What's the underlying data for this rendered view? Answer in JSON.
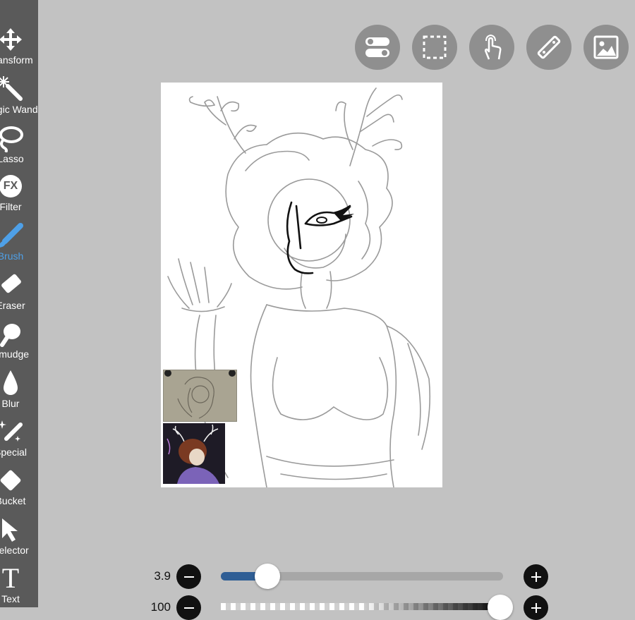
{
  "toolbar": {
    "tools": [
      {
        "id": "transform",
        "label": "Transform",
        "icon": "move-arrows-icon"
      },
      {
        "id": "magic-wand",
        "label": "Magic Wand",
        "icon": "magic-wand-icon"
      },
      {
        "id": "lasso",
        "label": "Lasso",
        "icon": "lasso-icon"
      },
      {
        "id": "filter",
        "label": "Filter",
        "icon": "fx-icon"
      },
      {
        "id": "brush",
        "label": "Brush",
        "icon": "brush-icon",
        "active": true
      },
      {
        "id": "eraser",
        "label": "Eraser",
        "icon": "eraser-icon"
      },
      {
        "id": "smudge",
        "label": "Smudge",
        "icon": "smudge-finger-icon"
      },
      {
        "id": "blur",
        "label": "Blur",
        "icon": "drop-icon"
      },
      {
        "id": "special",
        "label": "Special",
        "icon": "sparkle-brush-icon"
      },
      {
        "id": "bucket",
        "label": "Bucket",
        "icon": "bucket-diamond-icon"
      },
      {
        "id": "selector",
        "label": "Selector",
        "icon": "cursor-arrow-icon"
      },
      {
        "id": "text",
        "label": "Text",
        "icon": "text-t-icon"
      }
    ],
    "filter_glyph": "FX",
    "text_glyph": "T"
  },
  "top_buttons": [
    {
      "id": "toggle",
      "icon": "toggle-switches-icon"
    },
    {
      "id": "selection",
      "icon": "dashed-selection-icon"
    },
    {
      "id": "touch",
      "icon": "hand-touch-icon"
    },
    {
      "id": "ruler",
      "icon": "ruler-icon"
    },
    {
      "id": "gallery",
      "icon": "image-icon"
    }
  ],
  "brush_size": {
    "value": "3.9",
    "fraction": 0.13
  },
  "opacity": {
    "value": "100",
    "fraction": 1.0
  },
  "colors": {
    "toolbar_bg": "#5a5a5a",
    "workspace_bg": "#c2c2c2",
    "active_tool": "#4ea0e8",
    "slider_fill": "#2f5e95"
  }
}
